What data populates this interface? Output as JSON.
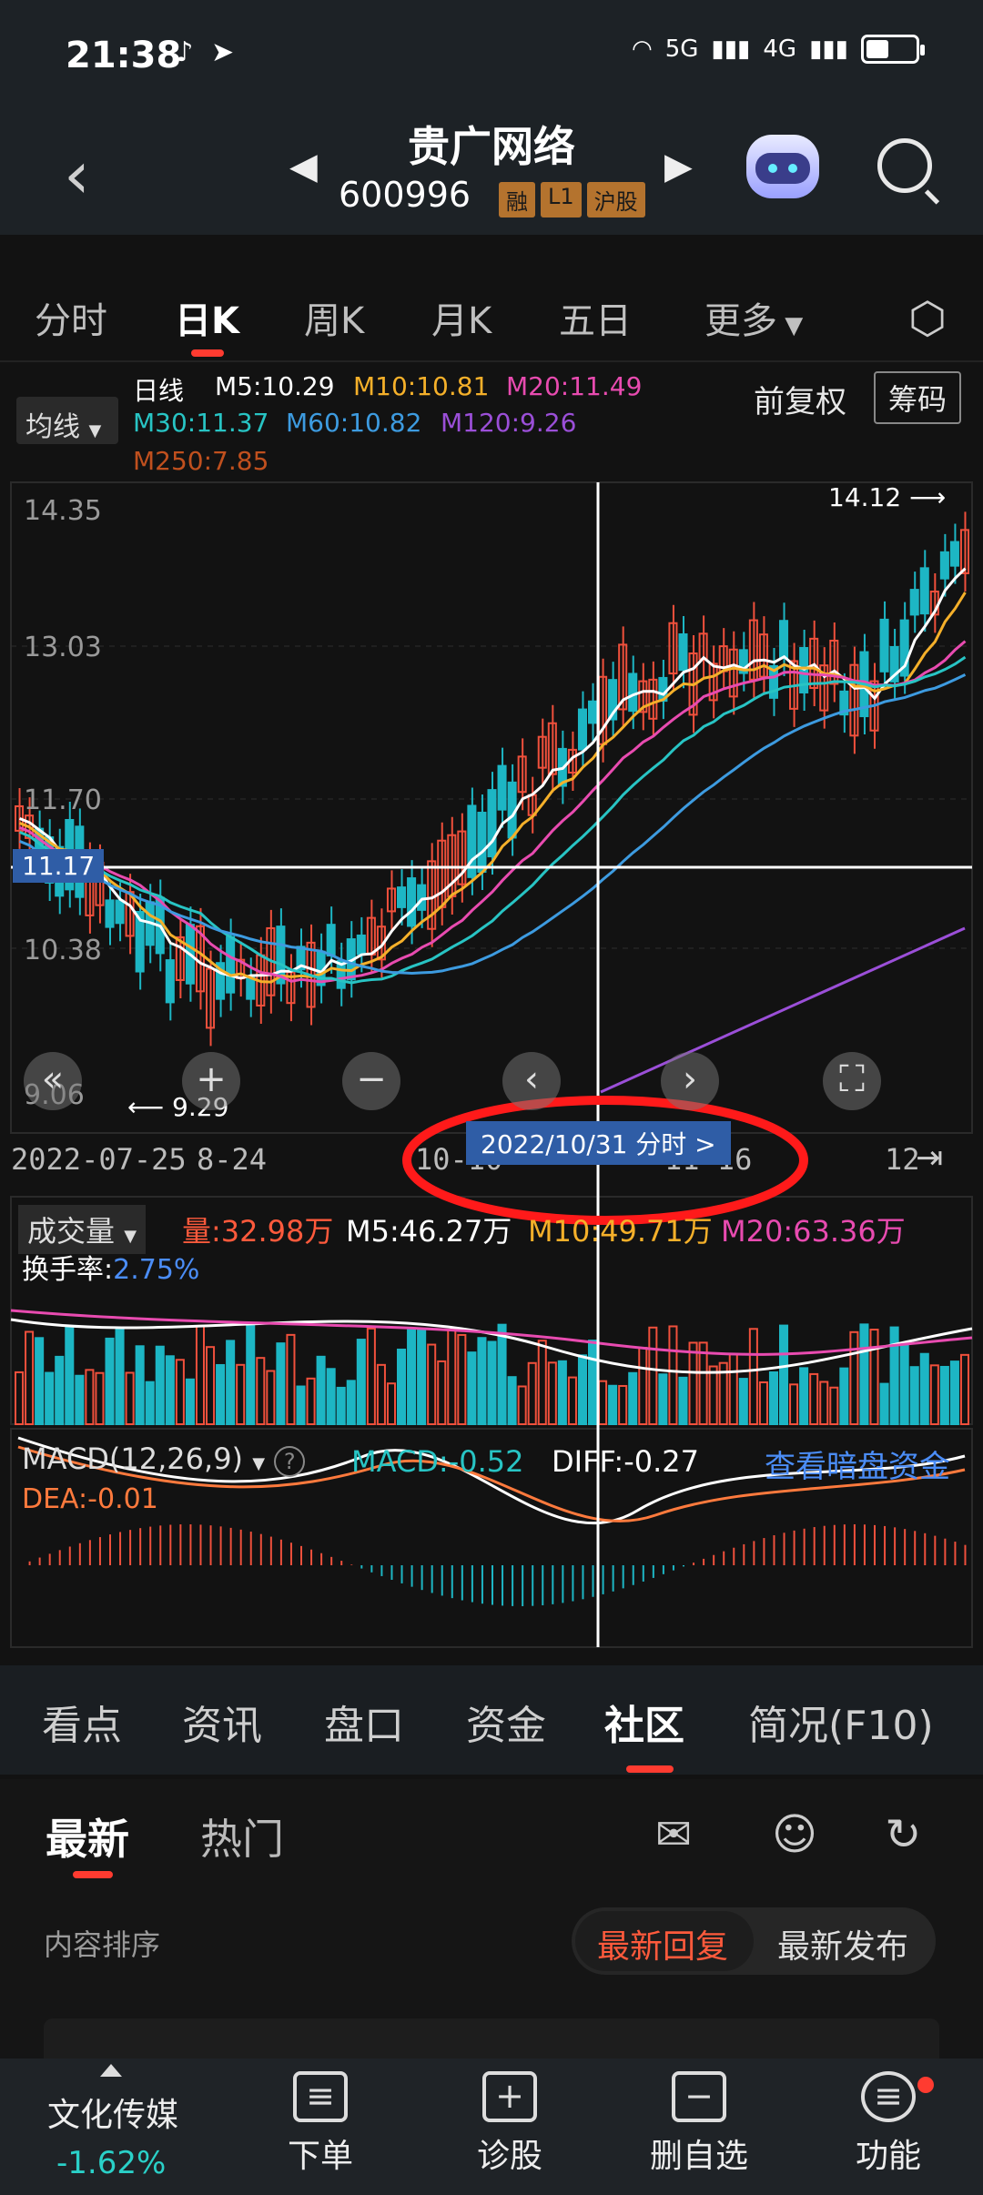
{
  "status": {
    "time": "21:38",
    "net1": "5G",
    "net2": "4G"
  },
  "header": {
    "stock_name": "贵广网络",
    "stock_code": "600996",
    "badges": [
      "融",
      "L1",
      "沪股"
    ]
  },
  "tabs": [
    "分时",
    "日K",
    "周K",
    "月K",
    "五日",
    "更多"
  ],
  "ma": {
    "button": "均线",
    "title": "日线",
    "m5": "M5:10.29",
    "m10": "M10:10.81",
    "m20": "M20:11.49",
    "m30": "M30:11.37",
    "m60": "M60:10.82",
    "m120": "M120:9.26",
    "m250": "M250:7.85",
    "fq": "前复权",
    "chouma": "筹码"
  },
  "chart_data": {
    "type": "candlestick",
    "y_ticks": [
      "14.35",
      "13.03",
      "11.70",
      "10.38",
      "9.06"
    ],
    "crosshair_price": "11.17",
    "high_label": "14.12",
    "low_label": "9.29",
    "x_labels": [
      "2022-07-25",
      "8-24",
      "10-10",
      "11-16",
      "12"
    ],
    "tooltip": "2022/10/31  分时  >"
  },
  "colors": {
    "up": "#f0503c",
    "down": "#1db6c4",
    "m5": "#ffffff",
    "m10": "#f5b02a",
    "m20": "#e84bb0",
    "m30": "#28c4c4",
    "m60": "#3d9be0",
    "m120": "#9b4fd8"
  },
  "volume": {
    "button": "成交量",
    "vol": "量:32.98万",
    "m5": "M5:46.27万",
    "m10": "M10:49.71万",
    "m20": "M20:63.36万",
    "turnover_label": "换手率:",
    "turnover_value": "2.75%"
  },
  "macd": {
    "button": "MACD(12,26,9)",
    "macd": "MACD:-0.52",
    "diff": "DIFF:-0.27",
    "dea": "DEA:-0.01",
    "dark_pool": "查看暗盘资金"
  },
  "bottom_tabs": [
    "看点",
    "资讯",
    "盘口",
    "资金",
    "社区",
    "简况(F10)"
  ],
  "community": {
    "tabs": [
      "最新",
      "热门"
    ],
    "sort_label": "内容排序",
    "sort_options": [
      "最新回复",
      "最新发布"
    ]
  },
  "bottombar": {
    "sector": "文化传媒",
    "sector_change": "-1.62%",
    "items": [
      "下单",
      "诊股",
      "删自选",
      "功能"
    ]
  }
}
